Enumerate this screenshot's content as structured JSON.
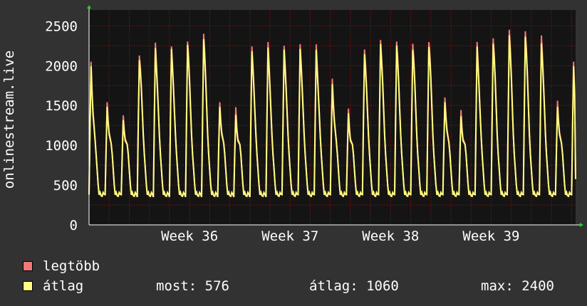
{
  "chart_data": {
    "type": "line",
    "ylabel": "onlinestream.live",
    "ylim": [
      0,
      2700
    ],
    "yticks": [
      0,
      500,
      1000,
      1500,
      2000,
      2500
    ],
    "xlim": [
      0,
      24.2
    ],
    "x_tick_positions": [
      5,
      10,
      15,
      20
    ],
    "x_tick_labels": [
      "Week 36",
      "Week 37",
      "Week 38",
      "Week 39"
    ],
    "grid": true,
    "days_peaks": [
      {
        "legtobb": 2080,
        "atlag": 2020,
        "evening": 1500
      },
      {
        "legtobb": 1560,
        "atlag": 1500,
        "evening": 1200
      },
      {
        "legtobb": 1390,
        "atlag": 1330,
        "evening": 1100
      },
      {
        "legtobb": 2140,
        "atlag": 2080,
        "evening": 1900
      },
      {
        "legtobb": 2310,
        "atlag": 2240,
        "evening": 1900
      },
      {
        "legtobb": 2260,
        "atlag": 2230,
        "evening": 1900
      },
      {
        "legtobb": 2320,
        "atlag": 2280,
        "evening": 2000
      },
      {
        "legtobb": 2420,
        "atlag": 2350,
        "evening": 2050
      },
      {
        "legtobb": 1560,
        "atlag": 1500,
        "evening": 1200
      },
      {
        "legtobb": 1500,
        "atlag": 1400,
        "evening": 1100
      },
      {
        "legtobb": 2260,
        "atlag": 2200,
        "evening": 1900
      },
      {
        "legtobb": 2320,
        "atlag": 2250,
        "evening": 1900
      },
      {
        "legtobb": 2270,
        "atlag": 2220,
        "evening": 1900
      },
      {
        "legtobb": 2290,
        "atlag": 2230,
        "evening": 1900
      },
      {
        "legtobb": 2290,
        "atlag": 2220,
        "evening": 1850
      },
      {
        "legtobb": 1860,
        "atlag": 1790,
        "evening": 1400
      },
      {
        "legtobb": 1480,
        "atlag": 1420,
        "evening": 1100
      },
      {
        "legtobb": 2220,
        "atlag": 2160,
        "evening": 1900
      },
      {
        "legtobb": 2340,
        "atlag": 2290,
        "evening": 2000
      },
      {
        "legtobb": 2320,
        "atlag": 2270,
        "evening": 2000
      },
      {
        "legtobb": 2290,
        "atlag": 2210,
        "evening": 2000
      },
      {
        "legtobb": 2310,
        "atlag": 2250,
        "evening": 2050
      },
      {
        "legtobb": 1620,
        "atlag": 1560,
        "evening": 1250
      },
      {
        "legtobb": 1460,
        "atlag": 1380,
        "evening": 1100
      },
      {
        "legtobb": 2320,
        "atlag": 2260,
        "evening": 1900
      },
      {
        "legtobb": 2360,
        "atlag": 2290,
        "evening": 2050
      },
      {
        "legtobb": 2470,
        "atlag": 2400,
        "evening": 2100
      },
      {
        "legtobb": 2450,
        "atlag": 2380,
        "evening": 2100
      },
      {
        "legtobb": 2400,
        "atlag": 2300,
        "evening": 2000
      },
      {
        "legtobb": 1580,
        "atlag": 1500,
        "evening": 1200
      }
    ],
    "series": [
      {
        "name": "legtöbb",
        "color": "#f07878"
      },
      {
        "name": "átlag",
        "color": "#ffff80"
      }
    ],
    "last_value": 576
  },
  "legend": {
    "legtobb_label": "legtöbb",
    "atlag_label": "átlag"
  },
  "stats": {
    "most": "most: 576",
    "atlag": "átlag: 1060",
    "max": "max: 2400"
  },
  "colors": {
    "background": "#323232",
    "plot_background": "#141414",
    "grid": "#8b1a1a",
    "axis": "#ffffff",
    "legtobb": "#f07878",
    "atlag": "#ffff80"
  }
}
